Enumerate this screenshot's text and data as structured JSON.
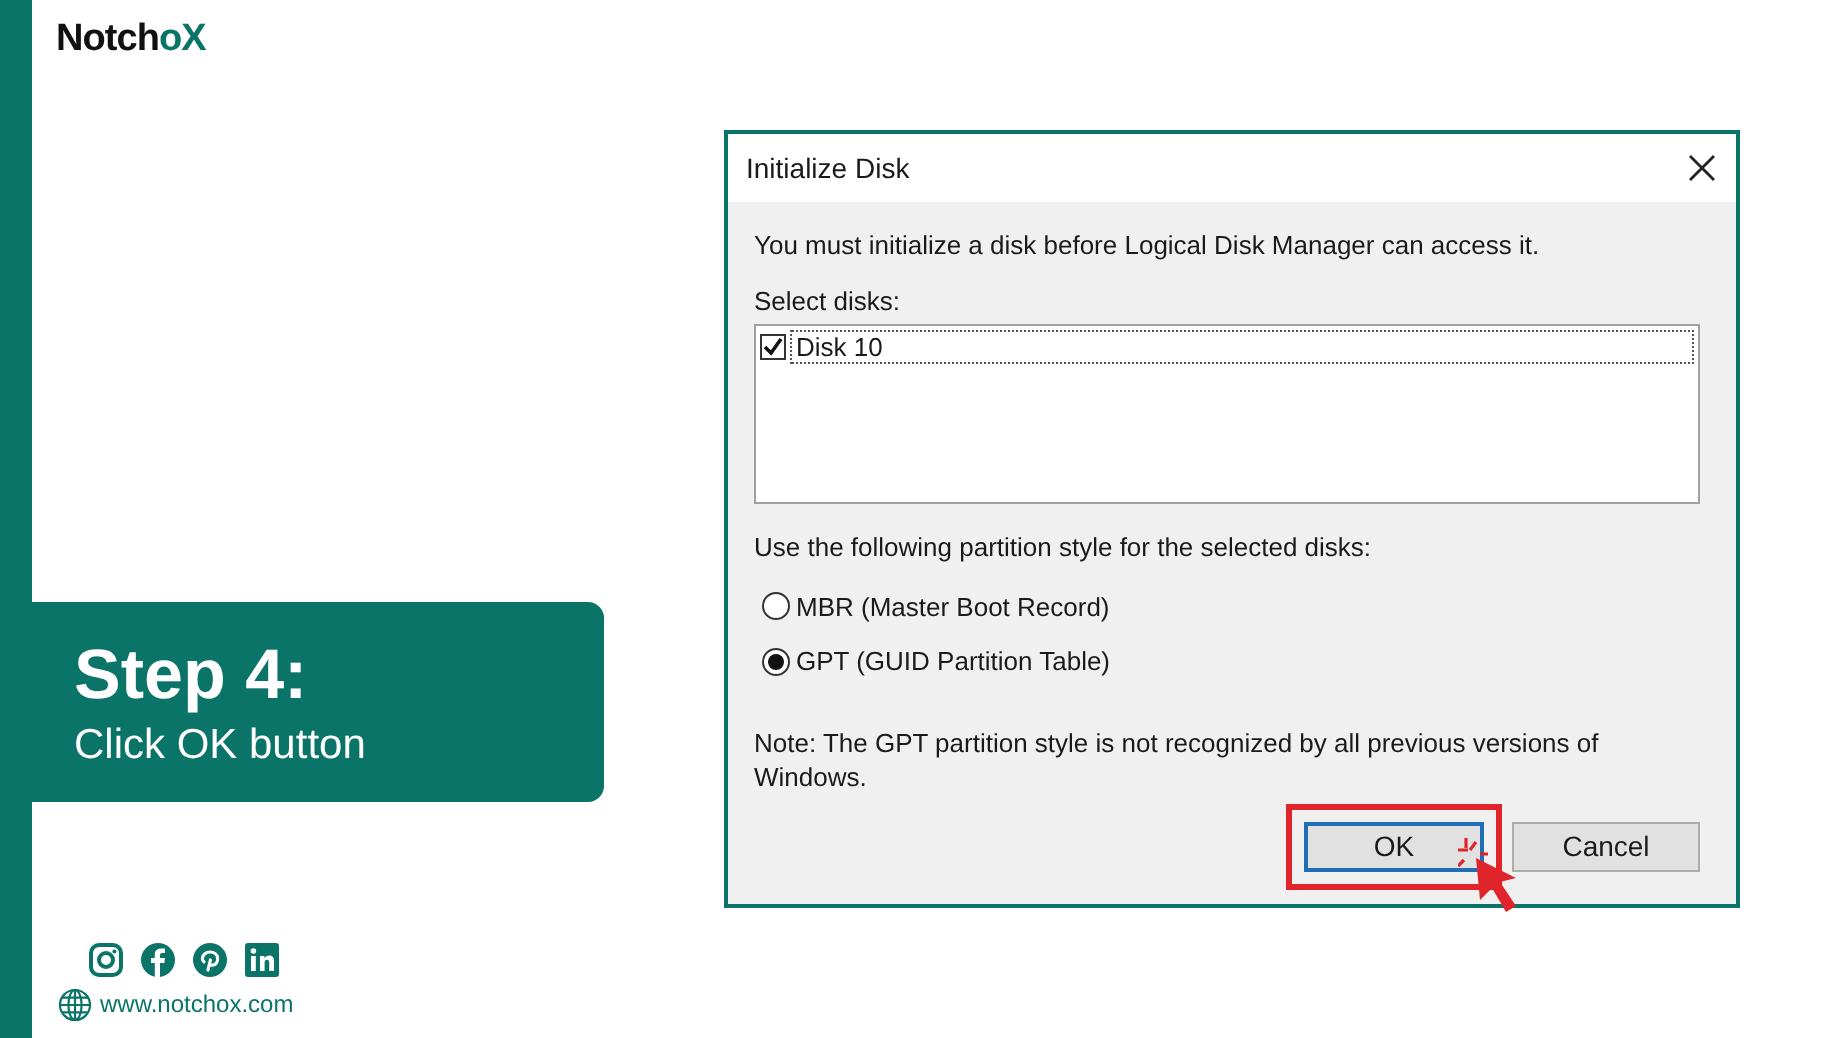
{
  "logo": {
    "dark": "Notch",
    "accent": "oX"
  },
  "step": {
    "title": "Step 4:",
    "subtitle": "Click OK button"
  },
  "website": "www.notchox.com",
  "dialog": {
    "title": "Initialize Disk",
    "message": "You must initialize a disk before Logical Disk Manager can access it.",
    "select_label": "Select disks:",
    "disks": [
      {
        "label": "Disk 10",
        "checked": true
      }
    ],
    "partition_label": "Use the following partition style for the selected disks:",
    "partition_styles": [
      {
        "label": "MBR (Master Boot Record)",
        "selected": false
      },
      {
        "label": "GPT (GUID Partition Table)",
        "selected": true
      }
    ],
    "note": "Note: The GPT partition style is not recognized by all previous versions of Windows.",
    "buttons": [
      {
        "label": "OK",
        "highlighted": true
      },
      {
        "label": "Cancel",
        "highlighted": false
      }
    ]
  }
}
